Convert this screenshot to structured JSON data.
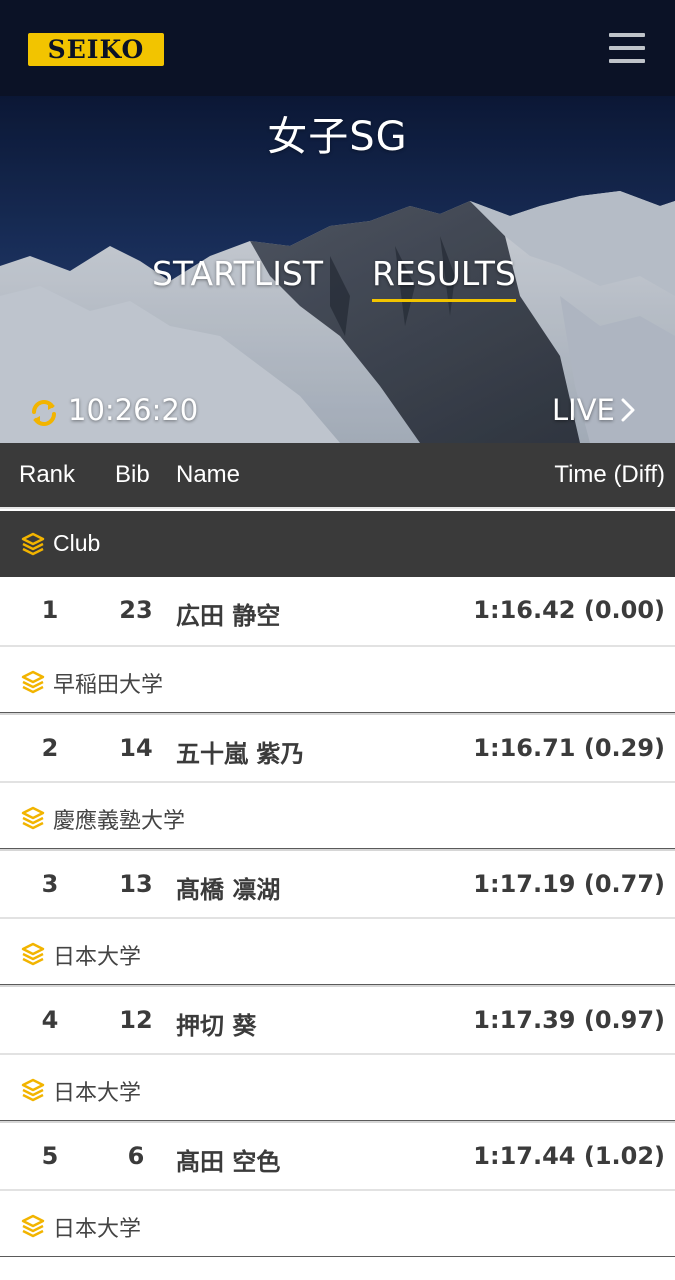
{
  "brand": {
    "logo_text": "SEIKO",
    "accent": "#f2c400"
  },
  "header": {
    "menu_icon": "hamburger-menu-icon"
  },
  "event": {
    "title": "女子SG"
  },
  "tabs": [
    {
      "label": "STARTLIST",
      "active": false
    },
    {
      "label": "RESULTS",
      "active": true
    }
  ],
  "status": {
    "time": "10:26:20",
    "refresh_icon": "refresh-icon",
    "live_label": "LIVE",
    "live_icon": "chevron-right-icon"
  },
  "table": {
    "columns": {
      "rank": "Rank",
      "bib": "Bib",
      "name": "Name",
      "time": "Time (Diff)"
    },
    "group_label": "Club",
    "rows": [
      {
        "rank": "1",
        "bib": "23",
        "name": "広田 静空",
        "time": "1:16.42 (0.00)",
        "club": "早稲田大学"
      },
      {
        "rank": "2",
        "bib": "14",
        "name": "五十嵐 紫乃",
        "time": "1:16.71 (0.29)",
        "club": "慶應義塾大学"
      },
      {
        "rank": "3",
        "bib": "13",
        "name": "髙橋 凛湖",
        "time": "1:17.19 (0.77)",
        "club": "日本大学"
      },
      {
        "rank": "4",
        "bib": "12",
        "name": "押切 葵",
        "time": "1:17.39 (0.97)",
        "club": "日本大学"
      },
      {
        "rank": "5",
        "bib": "6",
        "name": "髙田 空色",
        "time": "1:17.44 (1.02)",
        "club": "日本大学"
      }
    ]
  }
}
